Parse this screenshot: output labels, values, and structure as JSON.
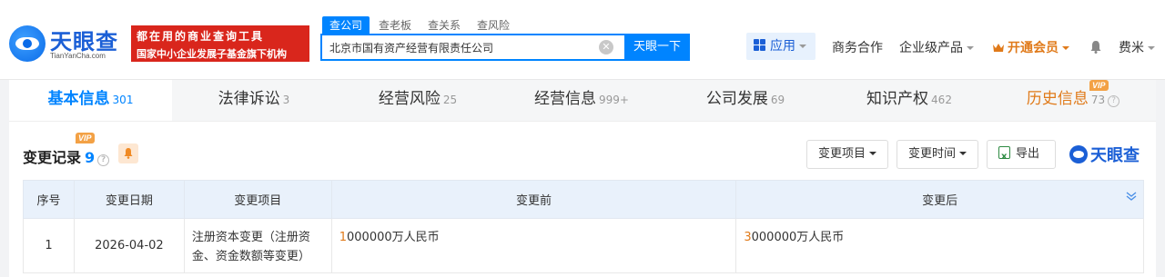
{
  "header": {
    "logo": {
      "name": "天眼查",
      "domain": "TianYanCha.com"
    },
    "promo": {
      "line1": "都在用的商业查询工具",
      "line2": "国家中小企业发展子基金旗下机构"
    },
    "search_tabs": [
      "查公司",
      "查老板",
      "查关系",
      "查风险"
    ],
    "search": {
      "value": "北京市国有资产经营有限责任公司",
      "button": "天眼一下"
    },
    "nav": {
      "apps": "应用",
      "business": "商务合作",
      "enterprise": "企业级产品",
      "vip": "开通会员",
      "user": "费米"
    }
  },
  "tabs": [
    {
      "label": "基本信息",
      "count": "301"
    },
    {
      "label": "法律诉讼",
      "count": "3"
    },
    {
      "label": "经营风险",
      "count": "25"
    },
    {
      "label": "经营信息",
      "count": "999+"
    },
    {
      "label": "公司发展",
      "count": "69"
    },
    {
      "label": "知识产权",
      "count": "462"
    },
    {
      "label": "历史信息",
      "count": "73",
      "badge": "VIP"
    }
  ],
  "section": {
    "title": "变更记录",
    "count": "9",
    "badge": "VIP",
    "buttons": {
      "items": "变更项目",
      "time": "变更时间",
      "export": "导出"
    },
    "brand": "天眼查"
  },
  "table": {
    "headers": [
      "序号",
      "变更日期",
      "变更项目",
      "变更前",
      "变更后"
    ],
    "rows": [
      {
        "index": "1",
        "date": "2026-04-02",
        "item": "注册资本变更（注册资金、资金数额等变更）",
        "before_first": "1",
        "before_rest": "000000万人民币",
        "after_first": "3",
        "after_rest": "000000万人民币"
      }
    ]
  }
}
